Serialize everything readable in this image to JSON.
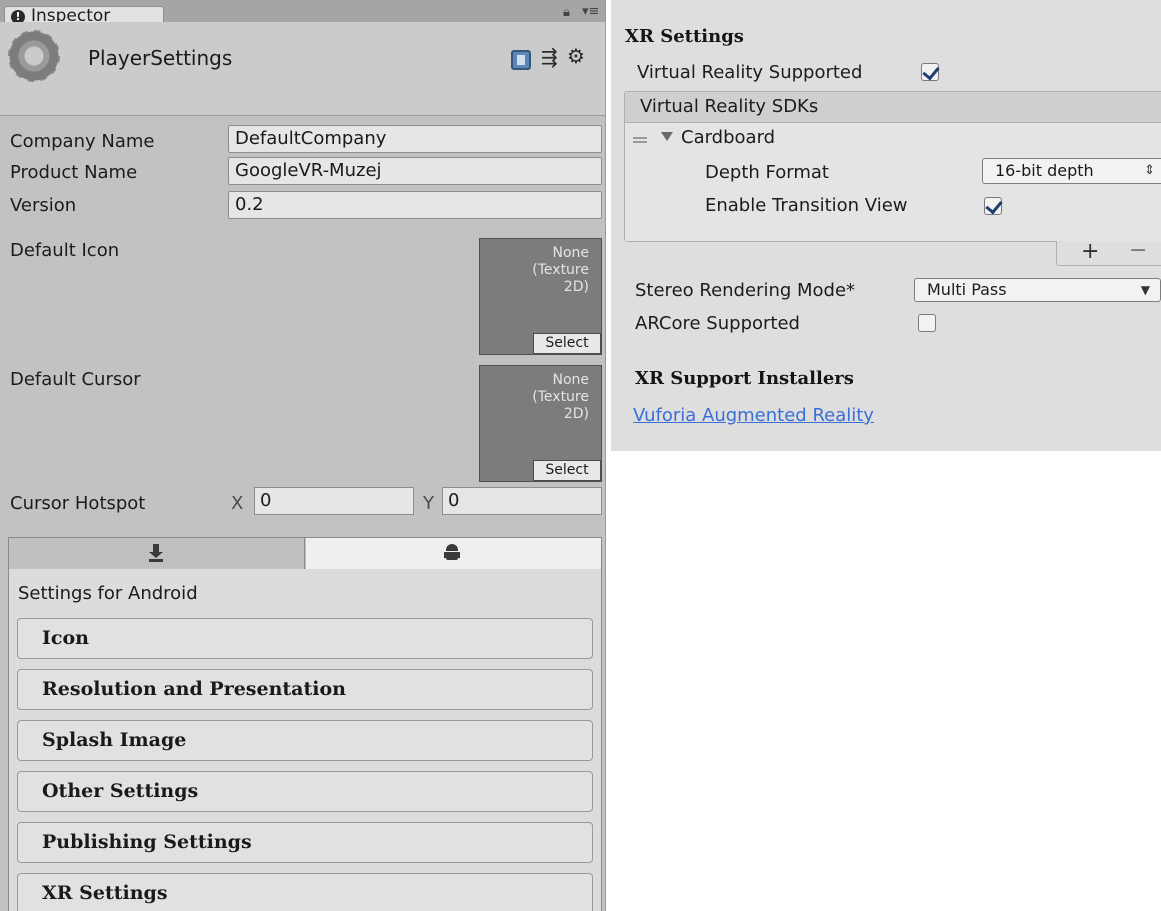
{
  "inspector": {
    "tab_label": "Inspector",
    "title": "PlayerSettings",
    "fields": {
      "company_name_label": "Company Name",
      "company_name_value": "DefaultCompany",
      "product_name_label": "Product Name",
      "product_name_value": "GoogleVR-Muzej",
      "version_label": "Version",
      "version_value": "0.2"
    },
    "default_icon": {
      "label": "Default Icon",
      "texture_text": "None\n(Texture\n2D)",
      "select_label": "Select"
    },
    "default_cursor": {
      "label": "Default Cursor",
      "texture_text": "None\n(Texture\n2D)",
      "select_label": "Select"
    },
    "cursor_hotspot": {
      "label": "Cursor Hotspot",
      "x_label": "X",
      "x_value": "0",
      "y_label": "Y",
      "y_value": "0"
    },
    "platform_tabs": [
      "standalone-icon",
      "android-icon"
    ],
    "selected_platform": "android",
    "settings_title": "Settings for Android",
    "sections": [
      "Icon",
      "Resolution and Presentation",
      "Splash Image",
      "Other Settings",
      "Publishing Settings",
      "XR Settings"
    ]
  },
  "xr_settings": {
    "title": "XR Settings",
    "vr_supported_label": "Virtual Reality Supported",
    "vr_supported_checked": true,
    "sdk_list_header": "Virtual Reality SDKs",
    "sdk": {
      "name": "Cardboard",
      "depth_format_label": "Depth Format",
      "depth_format_value": "16-bit depth",
      "enable_transition_label": "Enable Transition View",
      "enable_transition_checked": true
    },
    "plus_label": "+",
    "minus_label": "−",
    "stereo_rendering_label": "Stereo Rendering Mode*",
    "stereo_rendering_value": "Multi Pass",
    "arcore_label": "ARCore Supported",
    "arcore_checked": false,
    "installers_title": "XR Support Installers",
    "vuforia_link": "Vuforia Augmented Reality"
  },
  "colors": {
    "inspector_bg": "#c2c2c2",
    "xr_panel_bg": "#dedede",
    "link": "#3a6fd8",
    "check": "#1f3f70"
  }
}
